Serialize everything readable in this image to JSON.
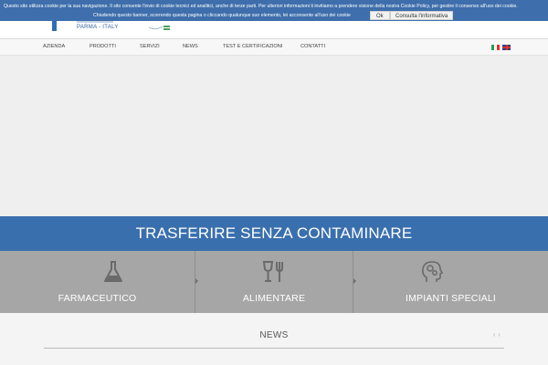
{
  "cookie": {
    "line1": "Questo sito utilizza cookie per la sua navigazione. Il sito consente l'invio di cookie tecnici ed analitici, anche di terze parti. Per ulteriori informazioni ti invitiamo a prendere visione della nostra Cookie Policy, per gestire il consenso all'uso dei cookie.",
    "line2": "Chiudendo questo banner, scorrendo questa pagina o cliccando qualunque suo elemento, lei acconsente all'uso dei cookie",
    "ok_label": "Ok",
    "info_label": "Consulta l'informativa"
  },
  "header": {
    "logo_location": "PARMA - ITALY"
  },
  "nav": {
    "items": [
      {
        "label": "AZIENDA"
      },
      {
        "label": "PRODOTTI"
      },
      {
        "label": "SERVIZI"
      },
      {
        "label": "NEWS"
      },
      {
        "label": "TEST E CERTIFICAZIONI"
      },
      {
        "label": "CONTATTI"
      }
    ],
    "languages": [
      "it",
      "en"
    ]
  },
  "hero": {
    "tagline": "TRASFERIRE SENZA CONTAMINARE"
  },
  "categories": [
    {
      "label": "FARMACEUTICO",
      "icon": "flask-icon"
    },
    {
      "label": "ALIMENTARE",
      "icon": "glass-fork-icon"
    },
    {
      "label": "IMPIANTI SPECIALI",
      "icon": "head-gears-icon"
    }
  ],
  "news": {
    "title": "NEWS",
    "prev": "‹",
    "next": "›"
  },
  "colors": {
    "brand_blue": "#3a6fae",
    "category_gray": "#a6a6a6"
  }
}
